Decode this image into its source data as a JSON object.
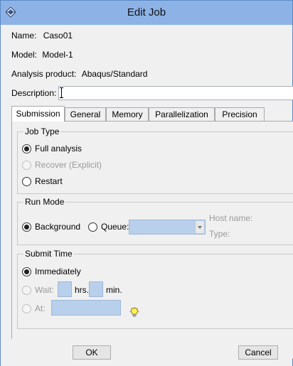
{
  "window": {
    "title": "Edit Job",
    "app_icon": "abaqus-diamond-icon"
  },
  "job": {
    "name_label": "Name:",
    "name_value": "Caso01",
    "model_label": "Model:",
    "model_value": "Model-1",
    "product_label": "Analysis product:",
    "product_value": "Abaqus/Standard",
    "description_label": "Description:",
    "description_value": ""
  },
  "tabs": [
    {
      "label": "Submission",
      "active": true
    },
    {
      "label": "General"
    },
    {
      "label": "Memory"
    },
    {
      "label": "Parallelization"
    },
    {
      "label": "Precision"
    }
  ],
  "job_type": {
    "title": "Job Type",
    "options": [
      {
        "label": "Full analysis",
        "checked": true,
        "enabled": true
      },
      {
        "label": "Recover (Explicit)",
        "checked": false,
        "enabled": false
      },
      {
        "label": "Restart",
        "checked": false,
        "enabled": true
      }
    ]
  },
  "run_mode": {
    "title": "Run Mode",
    "background_label": "Background",
    "queue_label": "Queue:",
    "queue_value": "",
    "host_label": "Host name:",
    "type_label": "Type:"
  },
  "submit_time": {
    "title": "Submit Time",
    "immediately_label": "Immediately",
    "wait_label": "Wait:",
    "hrs_label": "hrs.",
    "min_label": "min.",
    "at_label": "At:",
    "hrs_value": "",
    "min_value": "",
    "at_value": ""
  },
  "buttons": {
    "ok": "OK",
    "cancel": "Cancel"
  },
  "colors": {
    "titlebar": "#8db2e6",
    "field_fill": "#b8d0ec",
    "window_bg": "#f0f0f0"
  }
}
